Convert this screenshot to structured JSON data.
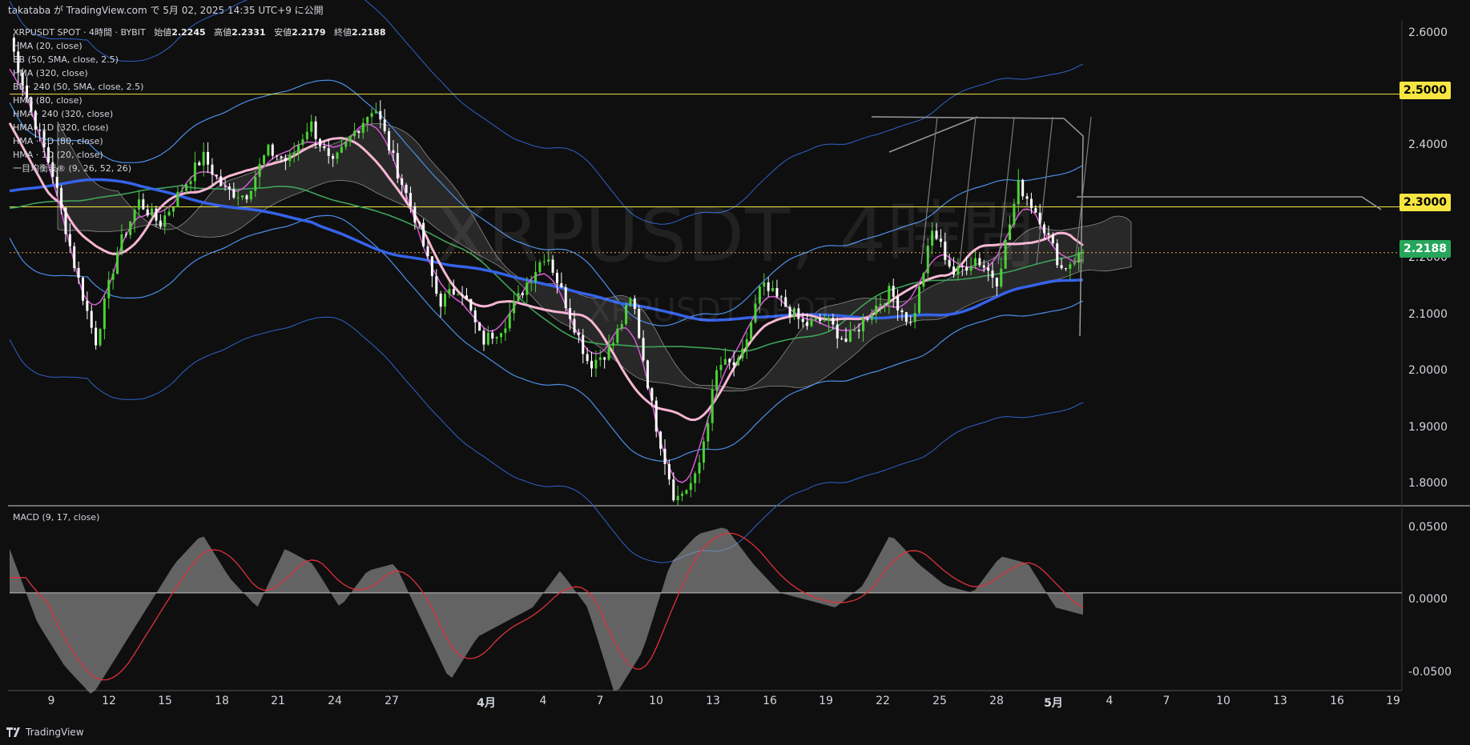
{
  "header": {
    "publish_text": "takataba が TradingView.com で 5月 02, 2025 14:35 UTC+9 に公開"
  },
  "legend": {
    "symbol_line": "XRPUSDT SPOT · 4時間 · BYBIT",
    "open_label": "始値",
    "open_value": "2.2245",
    "high_label": "高値",
    "high_value": "2.2331",
    "low_label": "安値",
    "low_value": "2.2179",
    "close_label": "終値",
    "close_value": "2.2188",
    "indicators": [
      "HMA (20, close)",
      "BB (50, SMA, close, 2.5)",
      "HMA (320, close)",
      "BB · 240 (50, SMA, close, 2.5)",
      "HMA (80, close)",
      "HMA · 240 (320, close)",
      "HMA · 1D (320, close)",
      "HMA · 1D (80, close)",
      "HMA · 1D (20, close)",
      "一目均衡表® (9, 26, 52, 26)"
    ]
  },
  "watermark": {
    "main": "XRPUSDT, 4時間",
    "sub": "XRPUSDT SPOT"
  },
  "price_axis": {
    "labels": [
      "2.6000",
      "2.4000",
      "2.2000",
      "2.1000",
      "2.0000",
      "1.9000",
      "1.8000"
    ],
    "tags": [
      {
        "text": "2.5000",
        "color": "#f5e642"
      },
      {
        "text": "2.3000",
        "color": "#f5e642"
      },
      {
        "text": "2.2188",
        "color": "#26a65b"
      }
    ]
  },
  "macd": {
    "title": "MACD (9, 17, close)",
    "labels": [
      "0.0500",
      "0.0000",
      "-0.0500"
    ]
  },
  "time_axis": {
    "ticks": [
      "9",
      "12",
      "15",
      "18",
      "21",
      "24",
      "27",
      "4月",
      "4",
      "7",
      "10",
      "13",
      "16",
      "19",
      "22",
      "25",
      "28",
      "5月",
      "4",
      "7",
      "10",
      "13",
      "16",
      "19"
    ]
  },
  "footer": {
    "brand": "TradingView"
  },
  "colors": {
    "bg": "#0f0f0f",
    "up": "#4cd137",
    "down": "#ffffff",
    "hma_pink": "#f7b6d2",
    "hma_blue": "#3563e9",
    "bb_blue": "#4a8fe7",
    "bb_green": "#3fa35a",
    "magenta": "#d65ad6",
    "level_yellow": "#f5e642"
  },
  "chart_data": {
    "type": "candlestick",
    "symbol": "XRPUSDT",
    "y_range": [
      1.77,
      2.63
    ],
    "horizontal_levels": [
      2.5,
      2.3,
      2.2188
    ],
    "last_close": 2.2188,
    "closes": [
      2.6,
      2.47,
      2.36,
      2.2,
      2.06,
      2.22,
      2.31,
      2.27,
      2.33,
      2.39,
      2.33,
      2.32,
      2.4,
      2.38,
      2.45,
      2.37,
      2.43,
      2.48,
      2.37,
      2.27,
      2.13,
      2.16,
      2.06,
      2.09,
      2.16,
      2.22,
      2.12,
      2.02,
      2.05,
      2.14,
      1.93,
      1.78,
      1.82,
      2.02,
      2.02,
      2.16,
      2.13,
      2.09,
      2.1,
      2.06,
      2.11,
      2.15,
      2.09,
      2.26,
      2.18,
      2.21,
      2.17,
      2.34,
      2.28,
      2.19,
      2.22
    ],
    "macd_range": [
      -0.065,
      0.055
    ],
    "macd_hist": [
      0.03,
      -0.02,
      -0.05,
      -0.07,
      -0.04,
      -0.01,
      0.02,
      0.04,
      0.01,
      -0.01,
      0.03,
      0.02,
      -0.01,
      0.015,
      0.02,
      -0.02,
      -0.06,
      -0.03,
      -0.02,
      -0.01,
      0.015,
      -0.01,
      -0.07,
      -0.04,
      0.02,
      0.04,
      0.045,
      0.02,
      0.0,
      -0.005,
      -0.01,
      0.005,
      0.04,
      0.02,
      0.005,
      0.0,
      0.025,
      0.02,
      -0.01,
      -0.015
    ]
  }
}
